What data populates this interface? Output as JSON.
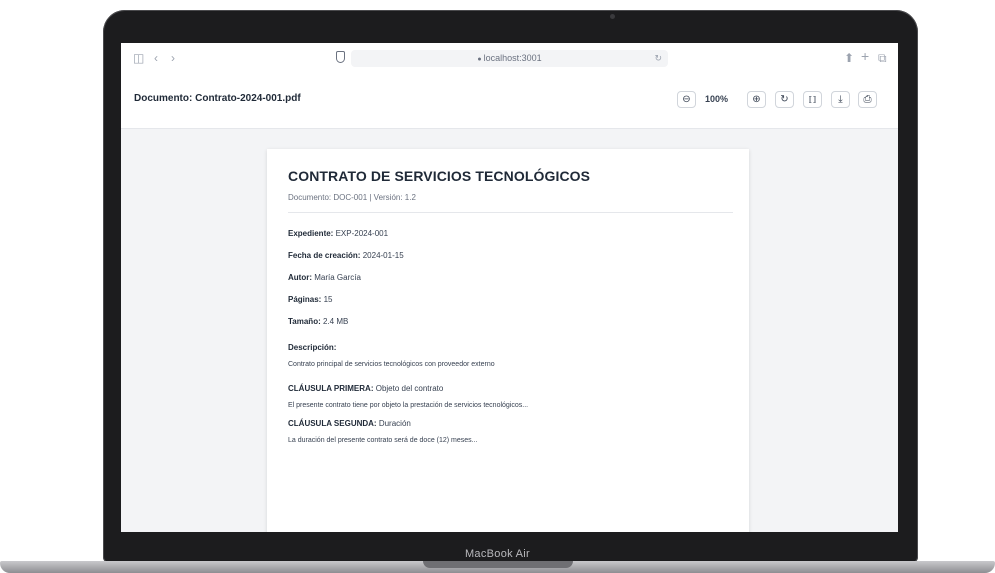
{
  "device": {
    "label": "MacBook Air"
  },
  "browser": {
    "url": "localhost:3001",
    "icons": {
      "sidebar": "sidebar-icon",
      "back": "chevron-left-icon",
      "forward": "chevron-right-icon",
      "shield": "shield-icon",
      "lock": "lock-icon",
      "reload": "reload-icon",
      "share": "share-icon",
      "new_tab": "plus-icon",
      "tabs": "tabs-icon"
    }
  },
  "header": {
    "title": "Documento: Contrato-2024-001.pdf",
    "zoom": "100%",
    "toolbar": [
      "zoom-out-icon",
      "zoom-in-icon",
      "rotate-icon",
      "fullscreen-icon",
      "download-icon",
      "print-icon"
    ]
  },
  "document": {
    "title": "CONTRATO DE SERVICIOS TECNOLÓGICOS",
    "meta": "Documento: DOC-001 | Versión: 1.2",
    "fields": [
      {
        "label": "Expediente:",
        "value": "EXP-2024-001"
      },
      {
        "label": "Fecha de creación:",
        "value": "2024-01-15"
      },
      {
        "label": "Autor:",
        "value": "María García"
      },
      {
        "label": "Páginas:",
        "value": "15"
      },
      {
        "label": "Tamaño:",
        "value": "2.4 MB"
      }
    ],
    "description_label": "Descripción:",
    "description": "Contrato principal de servicios tecnológicos con proveedor externo",
    "clauses": [
      {
        "title": "CLÁUSULA PRIMERA:",
        "subject": "Objeto del contrato",
        "text": "El presente contrato tiene por objeto la prestación de servicios tecnológicos..."
      },
      {
        "title": "CLÁUSULA SEGUNDA:",
        "subject": "Duración",
        "text": "La duración del presente contrato será de doce (12) meses..."
      }
    ]
  }
}
